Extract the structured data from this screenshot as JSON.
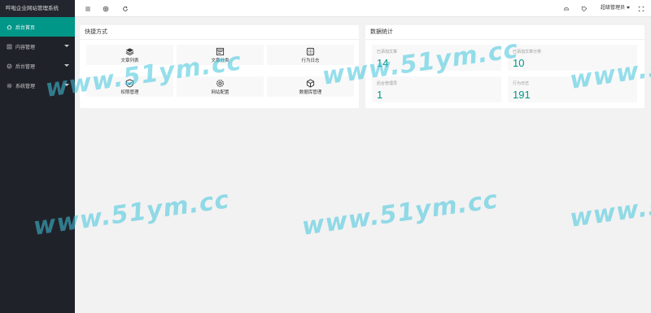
{
  "sidebar": {
    "app_title": "哔啦企业网站管理系统",
    "items": [
      {
        "label": "后台首页",
        "icon": "home-icon",
        "active": true
      },
      {
        "label": "内容管理",
        "icon": "content-icon",
        "active": false
      },
      {
        "label": "后台管理",
        "icon": "admin-icon",
        "active": false
      },
      {
        "label": "系统管理",
        "icon": "settings-icon",
        "active": false
      }
    ]
  },
  "header": {
    "user_name": "超级管理员"
  },
  "shortcuts": {
    "title": "快捷方式",
    "items": [
      {
        "label": "文章列表",
        "icon": "layers-icon"
      },
      {
        "label": "文章分类",
        "icon": "category-icon"
      },
      {
        "label": "行为日志",
        "icon": "log-icon"
      },
      {
        "label": "权限管理",
        "icon": "shield-check-icon"
      },
      {
        "label": "网站配置",
        "icon": "gear-icon"
      },
      {
        "label": "数据库管理",
        "icon": "database-icon"
      }
    ]
  },
  "stats": {
    "title": "数据统计",
    "items": [
      {
        "label": "已添加文章",
        "value": "14"
      },
      {
        "label": "已添加文章分类",
        "value": "10"
      },
      {
        "label": "后台管理员",
        "value": "1"
      },
      {
        "label": "行为日志",
        "value": "191"
      }
    ]
  },
  "watermark": {
    "text": "www.51ym.cc"
  }
}
